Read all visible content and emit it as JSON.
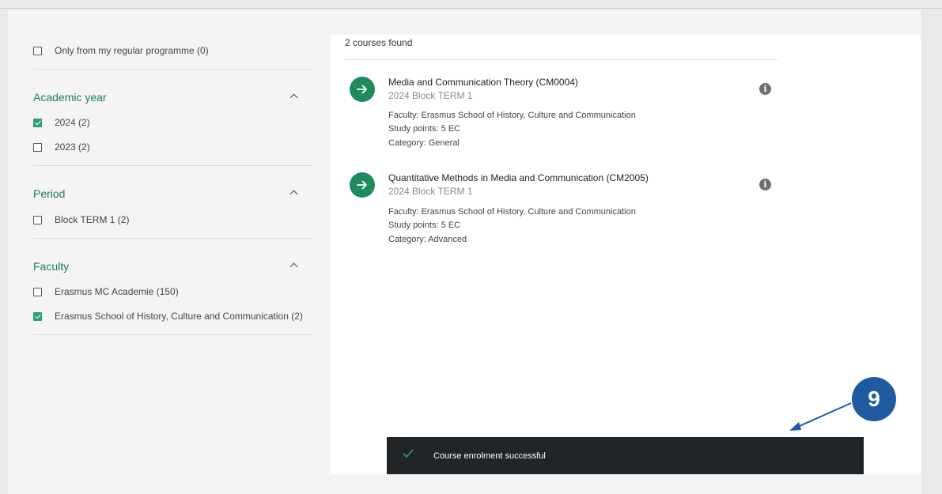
{
  "filters": {
    "regular_programme": {
      "label": "Only from my regular programme (0)",
      "checked": false
    },
    "sections": [
      {
        "title": "Academic year",
        "options": [
          {
            "label": "2024 (2)",
            "checked": true
          },
          {
            "label": "2023 (2)",
            "checked": false
          }
        ]
      },
      {
        "title": "Period",
        "options": [
          {
            "label": "Block TERM 1 (2)",
            "checked": false
          }
        ]
      },
      {
        "title": "Faculty",
        "options": [
          {
            "label": "Erasmus MC Academie (150)",
            "checked": false
          },
          {
            "label": "Erasmus School of History, Culture and Communication (2)",
            "checked": true
          }
        ]
      }
    ]
  },
  "results": {
    "count_text": "2 courses found",
    "courses": [
      {
        "title": "Media and Communication Theory (CM0004)",
        "subtitle": "2024 Block TERM 1",
        "faculty": "Faculty: Erasmus School of History, Culture and Communication",
        "study_points": "Study points: 5 EC",
        "category": "Category: General"
      },
      {
        "title": "Quantitative Methods in Media and Communication (CM2005)",
        "subtitle": "2024 Block TERM 1",
        "faculty": "Faculty: Erasmus School of History, Culture and Communication",
        "study_points": "Study points: 5 EC",
        "category": "Category: Advanced"
      }
    ]
  },
  "toast": {
    "message": "Course enrolment successful",
    "icon": "check-icon"
  },
  "annotation": {
    "step": "9"
  },
  "colors": {
    "accent_green": "#1f8a5e",
    "section_title": "#1f7a5a",
    "toast_bg": "#222528",
    "annotation_blue": "#1f5aa0"
  }
}
